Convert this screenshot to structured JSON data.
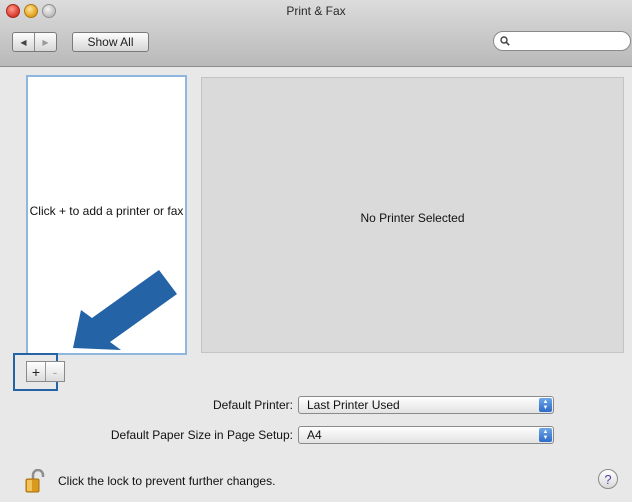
{
  "window": {
    "title": "Print & Fax"
  },
  "toolbar": {
    "back_icon": "◀",
    "forward_icon": "▶",
    "show_all_label": "Show All",
    "search": {
      "value": "",
      "placeholder": ""
    }
  },
  "printer_list": {
    "empty_hint": "Click + to add a printer or fax"
  },
  "detail": {
    "message": "No Printer Selected"
  },
  "list_controls": {
    "add_label": "+",
    "remove_label": "-"
  },
  "settings": {
    "default_printer": {
      "label": "Default Printer:",
      "value": "Last Printer Used"
    },
    "paper_size": {
      "label": "Default Paper Size in Page Setup:",
      "value": "A4"
    }
  },
  "footer": {
    "lock_text": "Click the lock to prevent further changes.",
    "help_label": "?"
  },
  "colors": {
    "annotation_arrow": "#2363a6",
    "list_focus_ring": "#8fb6dc"
  }
}
